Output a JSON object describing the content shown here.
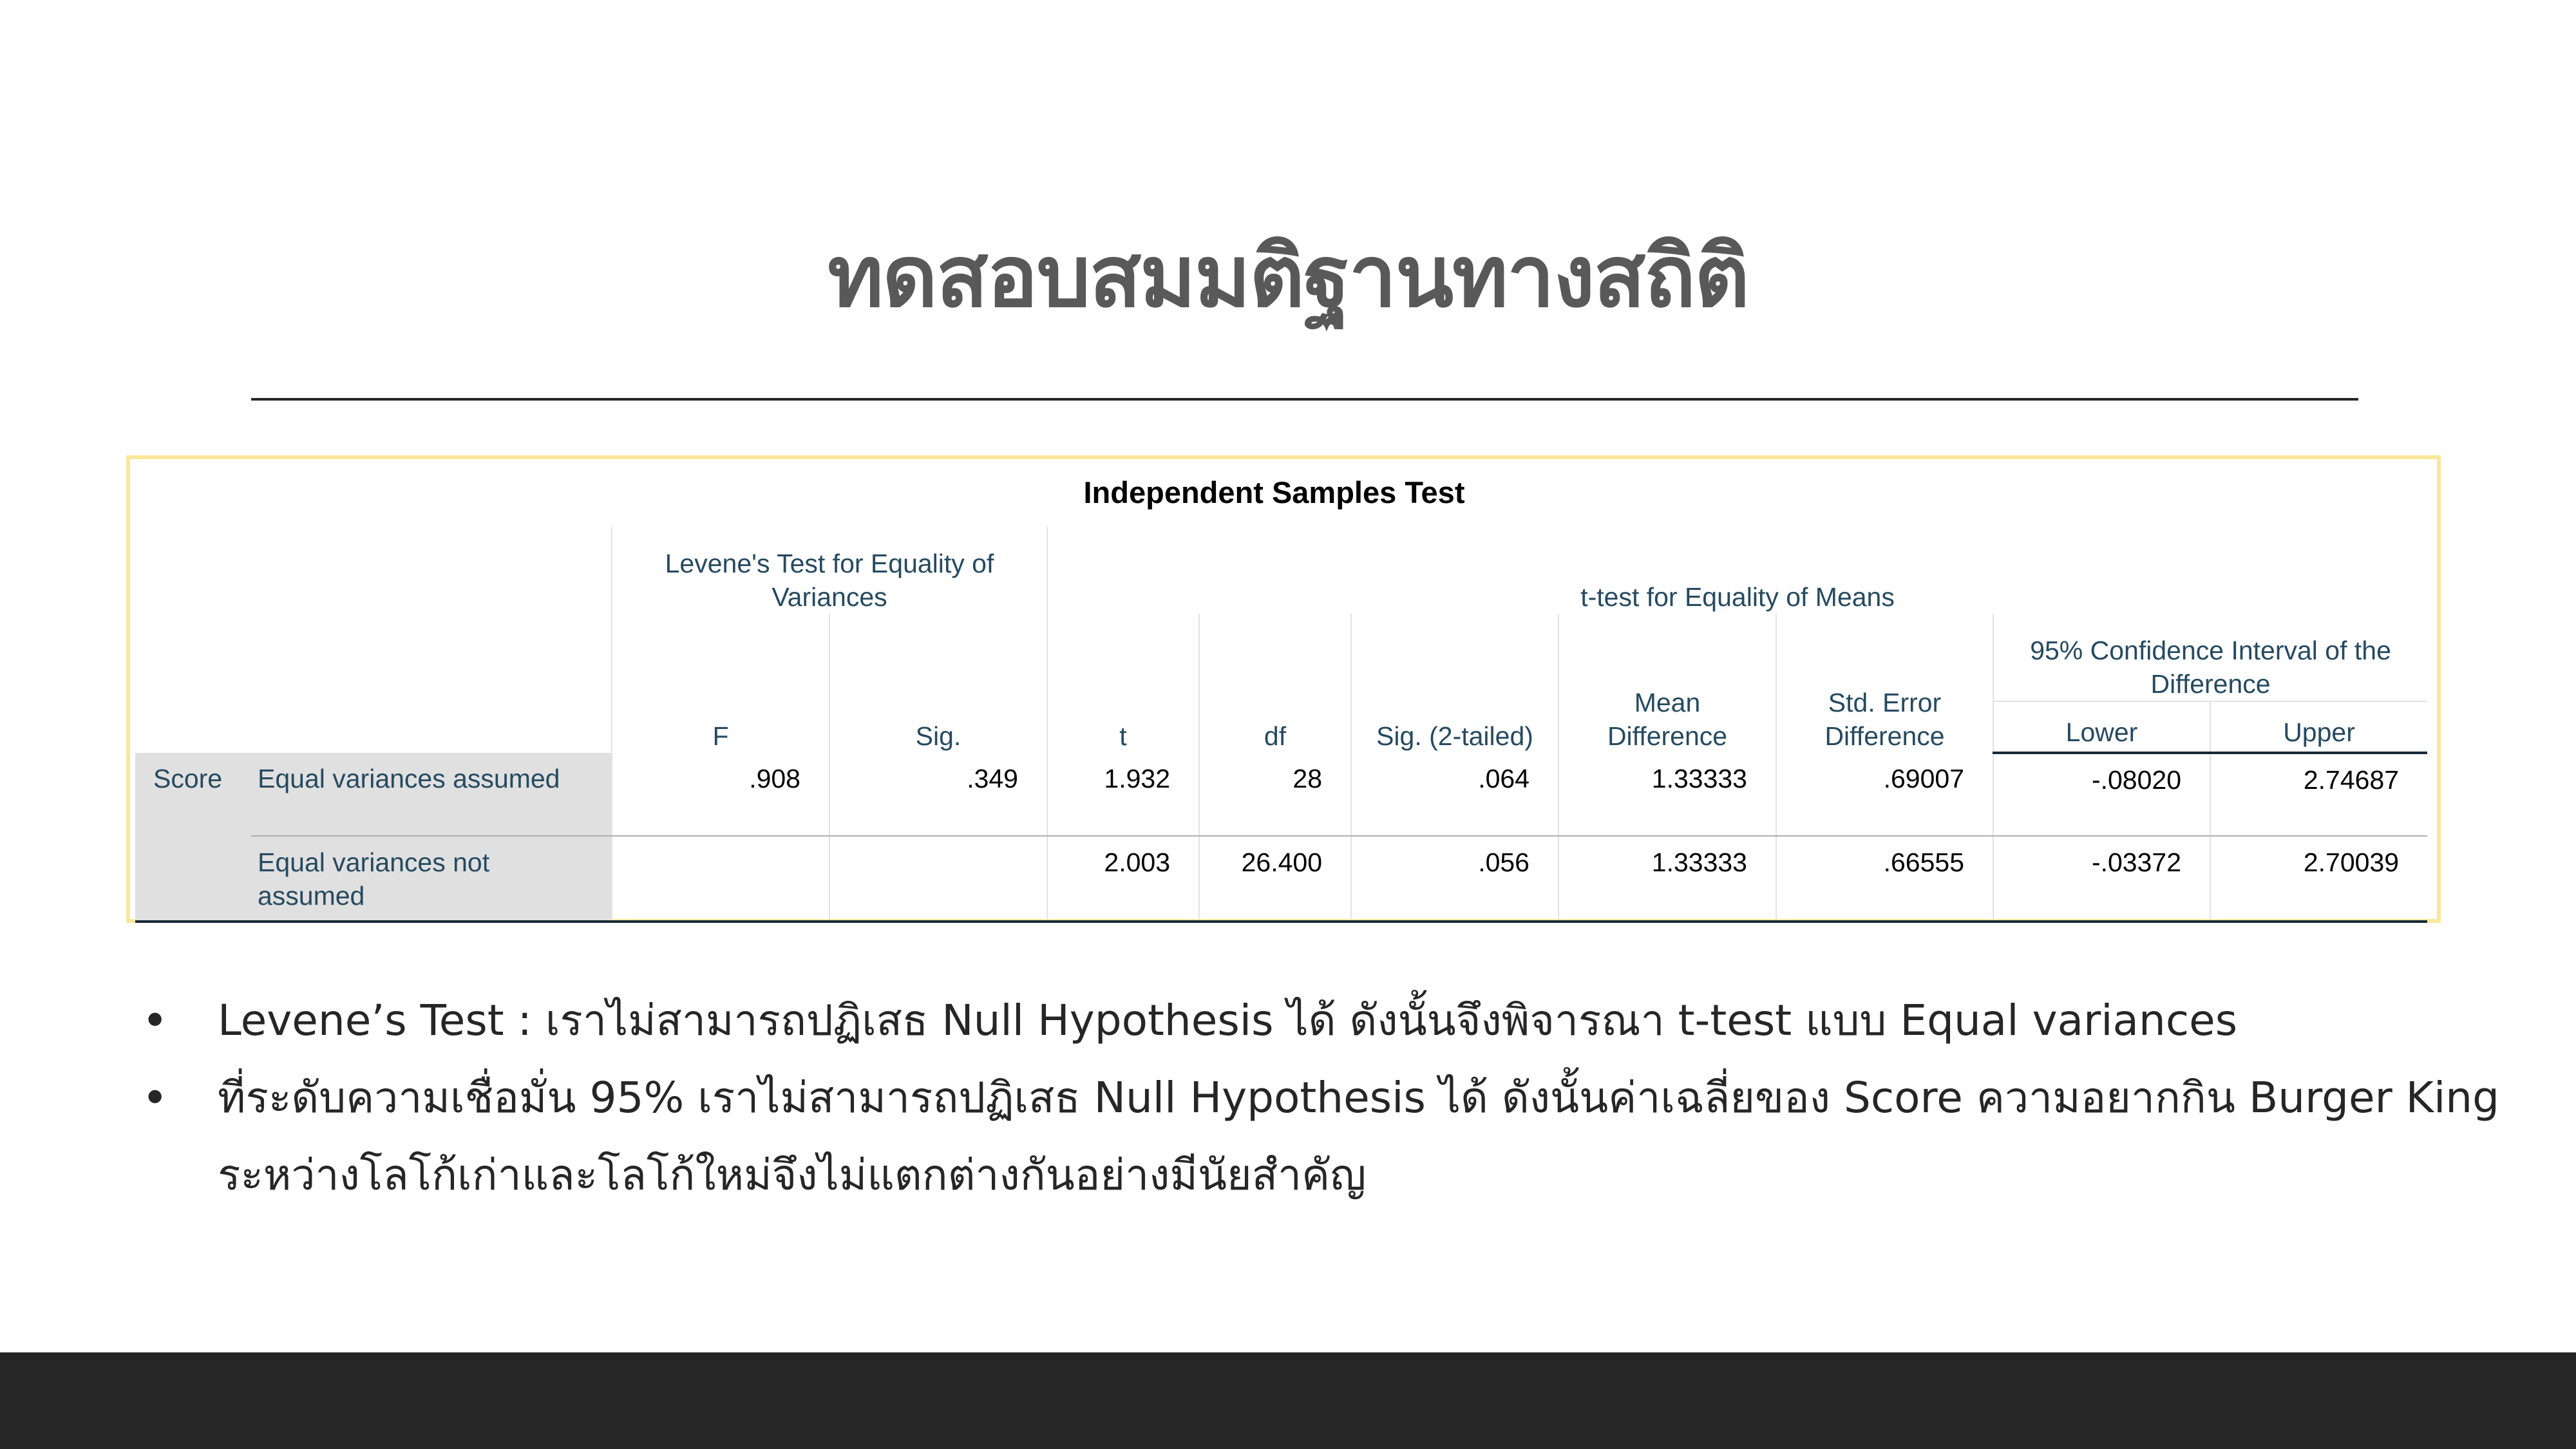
{
  "slide": {
    "title": "ทดสอบสมมติฐานทางสถิติ"
  },
  "spss": {
    "title": "Independent Samples Test",
    "levene_group": "Levene's Test for Equality of Variances",
    "ttest_group": "t-test for Equality of Means",
    "ci_group": "95% Confidence Interval of the Difference",
    "columns": {
      "F": "F",
      "sig": "Sig.",
      "t": "t",
      "df": "df",
      "sig2": "Sig. (2-tailed)",
      "mean_diff_1": "Mean",
      "mean_diff_2": "Difference",
      "se_diff_1": "Std. Error",
      "se_diff_2": "Difference",
      "lower": "Lower",
      "upper": "Upper"
    },
    "variable": "Score",
    "rows": [
      {
        "label": "Equal variances assumed",
        "F": ".908",
        "sig": ".349",
        "t": "1.932",
        "df": "28",
        "sig2": ".064",
        "mean_diff": "1.33333",
        "se_diff": ".69007",
        "lower": "-.08020",
        "upper": "2.74687"
      },
      {
        "label": "Equal variances not assumed",
        "F": "",
        "sig": "",
        "t": "2.003",
        "df": "26.400",
        "sig2": ".056",
        "mean_diff": "1.33333",
        "se_diff": ".66555",
        "lower": "-.03372",
        "upper": "2.70039"
      }
    ]
  },
  "bullets": [
    "Levene’s Test : เราไม่สามารถปฏิเสธ Null Hypothesis ได้ ดังนั้นจึงพิจารณา t-test แบบ Equal variances",
    "ที่ระดับความเชื่อมั่น 95% เราไม่สามารถปฏิเสธ Null Hypothesis ได้ ดังนั้นค่าเฉลี่ยของ Score ความอยากกิน Burger King ระหว่างโลโก้เก่าและโลโก้ใหม่จึงไม่แตกต่างกันอย่างมีนัยสำคัญ"
  ],
  "bullet_symbol": "•",
  "colors": {
    "frame_border": "#fae79a",
    "footer_bar": "#262626",
    "table_header_text": "#264a60",
    "row_label_bg": "#e0e0e0"
  }
}
